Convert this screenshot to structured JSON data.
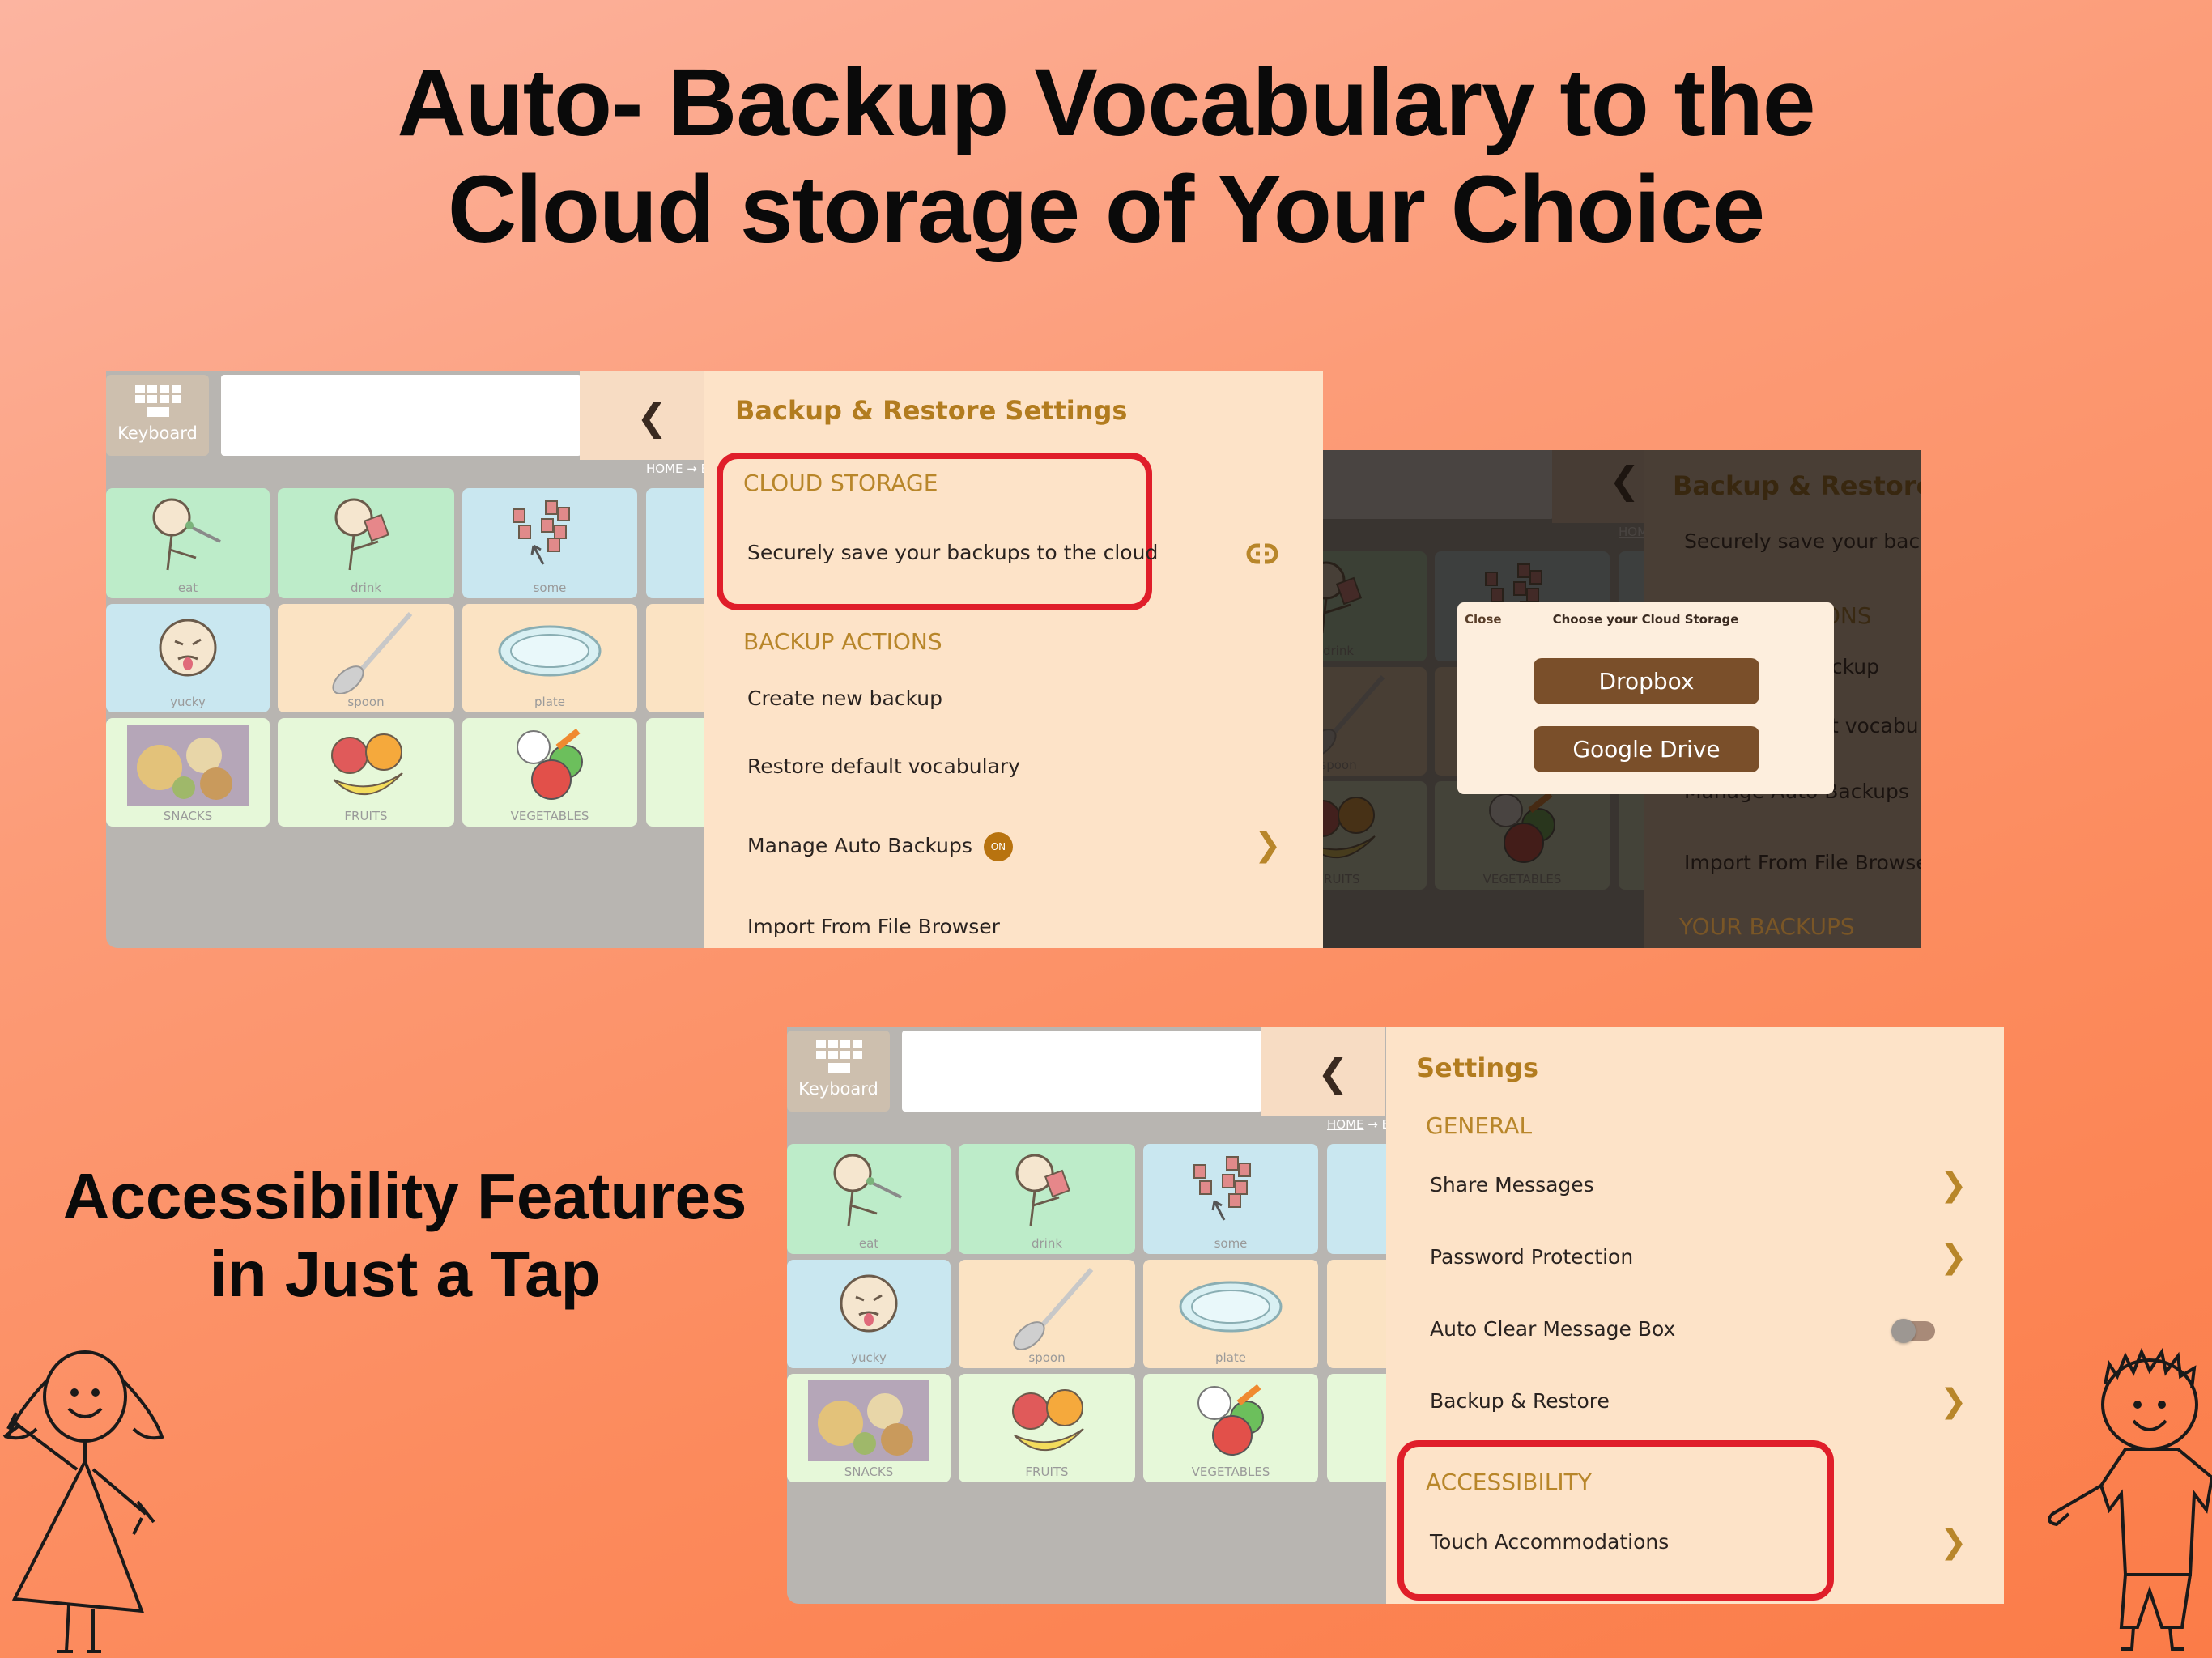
{
  "title": {
    "line1": "Auto- Backup Vocabulary to the",
    "line2": "Cloud storage of Your Choice"
  },
  "subtitle": {
    "line1": "Accessibility Features",
    "line2": "in Just a Tap"
  },
  "aac": {
    "keyboard_label": "Keyboard",
    "keyboard_icon": "keyboard-icon",
    "back_icon": "chevron-left-icon",
    "breadcrumb_home": "HOME",
    "breadcrumb_sep": "→",
    "breadcrumb_next": "E",
    "tiles": [
      {
        "label": "eat"
      },
      {
        "label": "drink"
      },
      {
        "label": "some"
      },
      {
        "label": "yucky"
      },
      {
        "label": "spoon"
      },
      {
        "label": "plate"
      },
      {
        "label": "SNACKS"
      },
      {
        "label": "FRUITS"
      },
      {
        "label": "VEGETABLES"
      }
    ]
  },
  "backup_settings": {
    "title": "Backup & Restore Settings",
    "cloud_header": "CLOUD STORAGE",
    "cloud_item": "Securely save your backups to the cloud",
    "cloud_icon": "link-icon",
    "actions_header": "BACKUP ACTIONS",
    "create": "Create new backup",
    "restore": "Restore default vocabulary",
    "manage": "Manage Auto Backups",
    "manage_badge": "ON",
    "import": "Import From File Browser",
    "your_backups_header": "YOUR BACKUPS"
  },
  "cloud_dialog": {
    "close": "Close",
    "title": "Choose your Cloud Storage",
    "options": [
      "Dropbox",
      "Google Drive"
    ]
  },
  "settings": {
    "title": "Settings",
    "general_header": "GENERAL",
    "items": [
      "Share Messages",
      "Password Protection",
      "Auto Clear Message Box",
      "Backup & Restore"
    ],
    "auto_clear_toggle": "off",
    "accessibility_header": "ACCESSIBILITY",
    "touch": "Touch Accommodations"
  },
  "colors": {
    "accent": "#b27c1f",
    "highlight": "#e01e2a",
    "button": "#7a4f2a",
    "panel": "#fde3c8"
  }
}
